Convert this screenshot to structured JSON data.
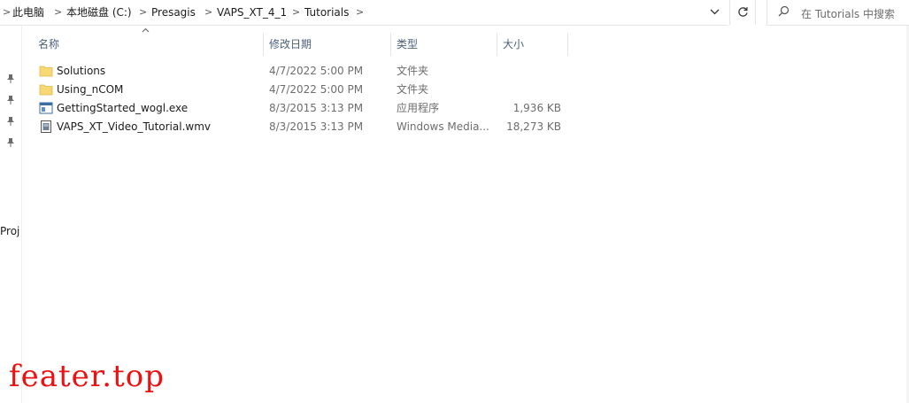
{
  "breadcrumb": {
    "items": [
      "此电脑",
      "本地磁盘 (C:)",
      "Presagis",
      "VAPS_XT_4_1",
      "Tutorials"
    ],
    "separator": ">"
  },
  "search": {
    "placeholder": "在 Tutorials 中搜索"
  },
  "icons": {
    "dropdown": "chevron-down-icon",
    "refresh": "refresh-icon",
    "search": "search-icon",
    "pin": "pin-icon"
  },
  "nav": {
    "label": "Proj"
  },
  "columns": {
    "name": "名称",
    "date": "修改日期",
    "type": "类型",
    "size": "大小"
  },
  "files": [
    {
      "name": "Solutions",
      "date": "4/7/2022 5:00 PM",
      "type": "文件夹",
      "size": "",
      "icon": "folder-icon"
    },
    {
      "name": "Using_nCOM",
      "date": "4/7/2022 5:00 PM",
      "type": "文件夹",
      "size": "",
      "icon": "folder-icon"
    },
    {
      "name": "GettingStarted_wogl.exe",
      "date": "8/3/2015 3:13 PM",
      "type": "应用程序",
      "size": "1,936 KB",
      "icon": "exe-icon"
    },
    {
      "name": "VAPS_XT_Video_Tutorial.wmv",
      "date": "8/3/2015 3:13 PM",
      "type": "Windows Media...",
      "size": "18,273 KB",
      "icon": "video-file-icon"
    }
  ],
  "watermark": "feater.top",
  "colors": {
    "folder": "#f8d775",
    "header_text": "#4c607a",
    "watermark": "#ee1111"
  }
}
